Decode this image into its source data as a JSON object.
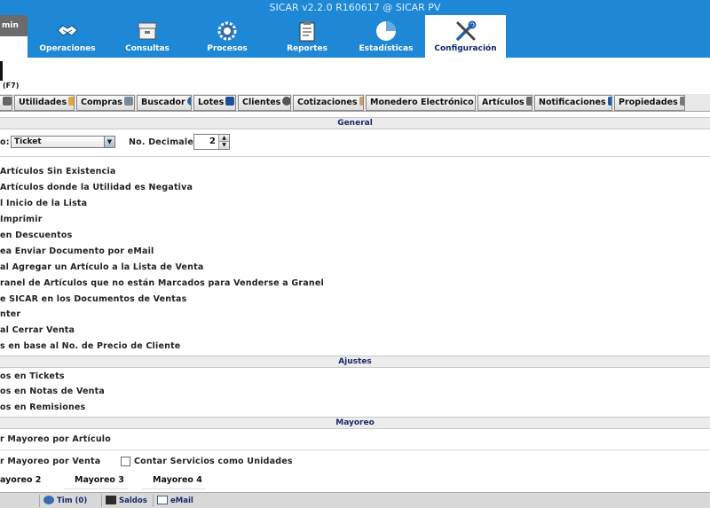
{
  "window": {
    "title": "SICAR v2.2.0 R160617 @ SICAR PV"
  },
  "user": {
    "label": "min"
  },
  "nav": [
    {
      "key": "operaciones",
      "label": "Operaciones"
    },
    {
      "key": "consultas",
      "label": "Consultas"
    },
    {
      "key": "procesos",
      "label": "Procesos"
    },
    {
      "key": "reportes",
      "label": "Reportes"
    },
    {
      "key": "estadisticas",
      "label": "Estadísticas"
    },
    {
      "key": "configuracion",
      "label": "Configuración",
      "active": true
    }
  ],
  "subheader": {
    "shortcut": "(F7)"
  },
  "tabs": [
    {
      "label": "Utilidades"
    },
    {
      "label": "Compras"
    },
    {
      "label": "Buscador"
    },
    {
      "label": "Lotes"
    },
    {
      "label": "Clientes"
    },
    {
      "label": "Cotizaciones"
    },
    {
      "label": "Monedero Electrónico"
    },
    {
      "label": "Artículos"
    },
    {
      "label": "Notificaciones"
    },
    {
      "label": "Propiedades"
    }
  ],
  "sections": {
    "general": "General",
    "ajustes": "Ajustes",
    "mayoreo": "Mayoreo"
  },
  "general": {
    "format_label": "o:",
    "format_value": "Ticket",
    "decimals_label": "No. Decimales:",
    "decimals_value": "2",
    "options": [
      "Artículos Sin Existencia",
      "Artículos donde la Utilidad es Negativa",
      "l Inicio de la Lista",
      "Imprimir",
      "en Descuentos",
      "ea Enviar Documento por eMail",
      "al Agregar un Artículo a la Lista de Venta",
      "ranel de Artículos que no están Marcados para Venderse a Granel",
      "e SICAR en los Documentos de Ventas",
      "nter",
      "al Cerrar Venta",
      "s en base al No. de Precio de Cliente"
    ]
  },
  "ajustes": {
    "options": [
      "os en Tickets",
      "os en Notas de Venta",
      "os en Remisiones"
    ]
  },
  "mayoreo": {
    "per_article": "r Mayoreo por Artículo",
    "per_sale": "r Mayoreo por Venta",
    "count_services": "Contar Servicios como Unidades",
    "levels": [
      "ayoreo 2",
      "Mayoreo 3",
      "Mayoreo 4"
    ]
  },
  "statusbar": {
    "tim": "Tim (0)",
    "saldos": "Saldos",
    "email": "eMail"
  }
}
